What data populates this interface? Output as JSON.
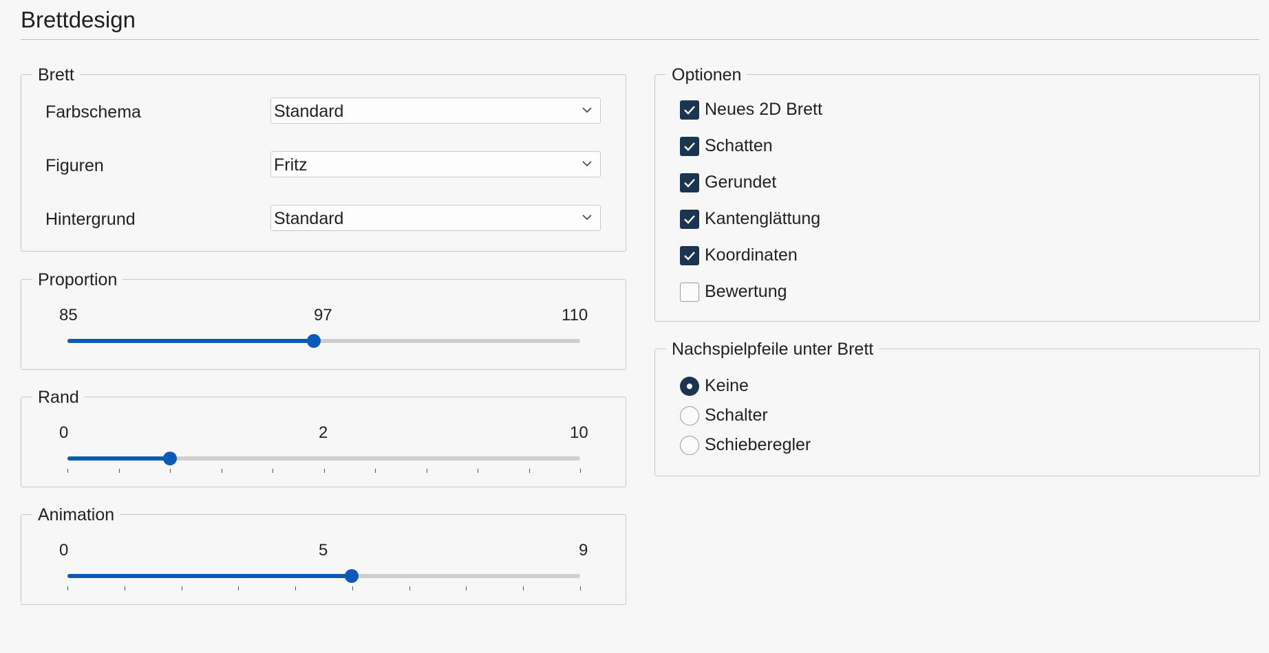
{
  "page": {
    "title": "Brettdesign"
  },
  "board": {
    "legend": "Brett",
    "rows": [
      {
        "label": "Farbschema",
        "value": "Standard"
      },
      {
        "label": "Figuren",
        "value": "Fritz"
      },
      {
        "label": "Hintergrund",
        "value": "Standard"
      }
    ]
  },
  "proportion": {
    "legend": "Proportion",
    "min": "85",
    "value": "97",
    "max": "110",
    "fraction": 0.48
  },
  "rand": {
    "legend": "Rand",
    "min": "0",
    "value": "2",
    "max": "10",
    "fraction": 0.2
  },
  "animation": {
    "legend": "Animation",
    "min": "0",
    "value": "5",
    "max": "9",
    "fraction": 0.555
  },
  "options": {
    "legend": "Optionen",
    "items": [
      {
        "label": "Neues 2D Brett",
        "checked": true
      },
      {
        "label": "Schatten",
        "checked": true
      },
      {
        "label": "Gerundet",
        "checked": true
      },
      {
        "label": "Kantenglättung",
        "checked": true
      },
      {
        "label": "Koordinaten",
        "checked": true
      },
      {
        "label": "Bewertung",
        "checked": false
      }
    ]
  },
  "arrows": {
    "legend": "Nachspielpfeile unter Brett",
    "items": [
      {
        "label": "Keine",
        "selected": true
      },
      {
        "label": "Schalter",
        "selected": false
      },
      {
        "label": "Schieberegler",
        "selected": false
      }
    ]
  },
  "colors": {
    "accent": "#0a5bb8",
    "checkbox": "#1b3450",
    "track": "#cfcfcf"
  }
}
